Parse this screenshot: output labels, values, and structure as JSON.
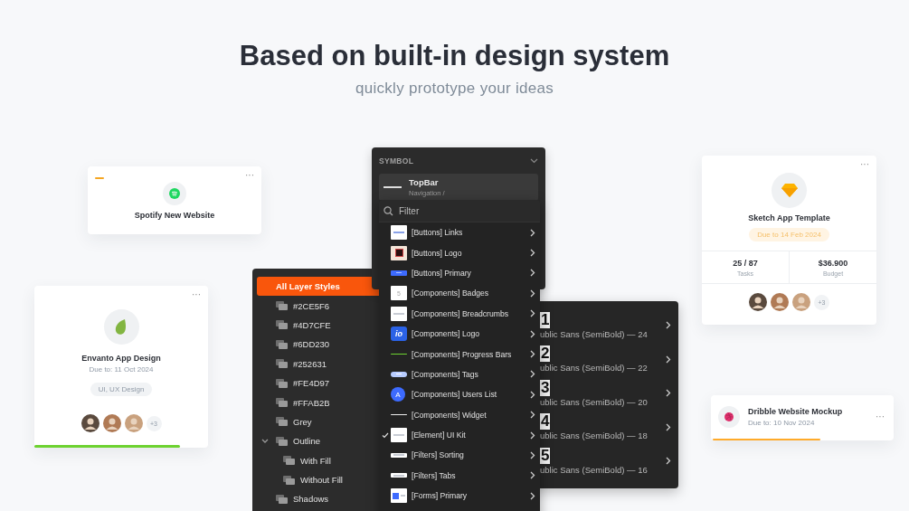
{
  "heading": "Based on built-in design system",
  "subheading": "quickly prototype your ideas",
  "spotify_card": {
    "menu": "···",
    "title": "Spotify New Website"
  },
  "envanto_card": {
    "menu": "···",
    "title": "Envanto App Design",
    "due": "Due to: 11 Oct 2024",
    "tag": "UI, UX Design",
    "extra_members": "+3",
    "level": 0.84
  },
  "layer_styles": {
    "items": [
      {
        "label": "All Layer Styles",
        "selected": true
      },
      {
        "label": "#2CE5F6",
        "selected": false
      },
      {
        "label": "#4D7CFE",
        "selected": false
      },
      {
        "label": "#6DD230",
        "selected": false
      },
      {
        "label": "#252631",
        "selected": false
      },
      {
        "label": "#FE4D97",
        "selected": false
      },
      {
        "label": "#FFAB2B",
        "selected": false
      },
      {
        "label": "Grey",
        "selected": false
      },
      {
        "label": "Outline",
        "selected": false,
        "expanded": true,
        "children": [
          {
            "label": "With Fill",
            "selected": false
          },
          {
            "label": "Without Fill",
            "selected": false
          }
        ]
      },
      {
        "label": "Shadows",
        "selected": false
      }
    ]
  },
  "symbol": {
    "header": "SYMBOL",
    "name": "TopBar",
    "path": "Navigation /"
  },
  "dropdown": {
    "placeholder": "Filter",
    "items": [
      {
        "label": "[Buttons] Links",
        "kind": "link",
        "checked": false
      },
      {
        "label": "[Buttons] Logo",
        "kind": "logo",
        "checked": false
      },
      {
        "label": "[Buttons] Primary",
        "kind": "primary",
        "checked": false
      },
      {
        "label": "[Components] Badges",
        "kind": "badge",
        "thumb_text": "5",
        "checked": false
      },
      {
        "label": "[Components] Breadcrumbs",
        "kind": "breadcrumb",
        "checked": false
      },
      {
        "label": "[Components] Logo",
        "kind": "io",
        "thumb_text": "io",
        "checked": false
      },
      {
        "label": "[Components] Progress Bars",
        "kind": "greenline",
        "checked": false
      },
      {
        "label": "[Components] Tags",
        "kind": "tag",
        "checked": false
      },
      {
        "label": "[Components] Users List",
        "kind": "avatar",
        "thumb_text": "A",
        "checked": false
      },
      {
        "label": "[Components] Widget",
        "kind": "whiteline",
        "checked": false
      },
      {
        "label": "[Element] UI Kit",
        "kind": "uikit",
        "checked": true
      },
      {
        "label": "[Filters] Sorting",
        "kind": "sorting",
        "checked": false
      },
      {
        "label": "[Filters] Tabs",
        "kind": "tabs",
        "checked": false
      },
      {
        "label": "[Forms] Primary",
        "kind": "forms",
        "checked": false
      }
    ]
  },
  "text_styles": {
    "items": [
      {
        "number": "1",
        "label": "ublic Sans (SemiBold) — 24"
      },
      {
        "number": "2",
        "label": "ublic Sans (SemiBold) — 22"
      },
      {
        "number": "3",
        "label": "ublic Sans (SemiBold) — 20"
      },
      {
        "number": "4",
        "label": "ublic Sans (SemiBold) — 18"
      },
      {
        "number": "5",
        "label": "ublic Sans (SemiBold) — 16"
      }
    ]
  },
  "sketch_card": {
    "menu": "···",
    "title": "Sketch App Template",
    "due": "Due to 14 Feb 2024",
    "stats": [
      {
        "value": "25 / 87",
        "label": "Tasks"
      },
      {
        "value": "$36.900",
        "label": "Budget"
      }
    ],
    "extra_members": "+3"
  },
  "dribble_card": {
    "title": "Dribble Website Mockup",
    "due": "Due to: 10 Nov 2024",
    "menu": "···",
    "level": 0.6
  }
}
